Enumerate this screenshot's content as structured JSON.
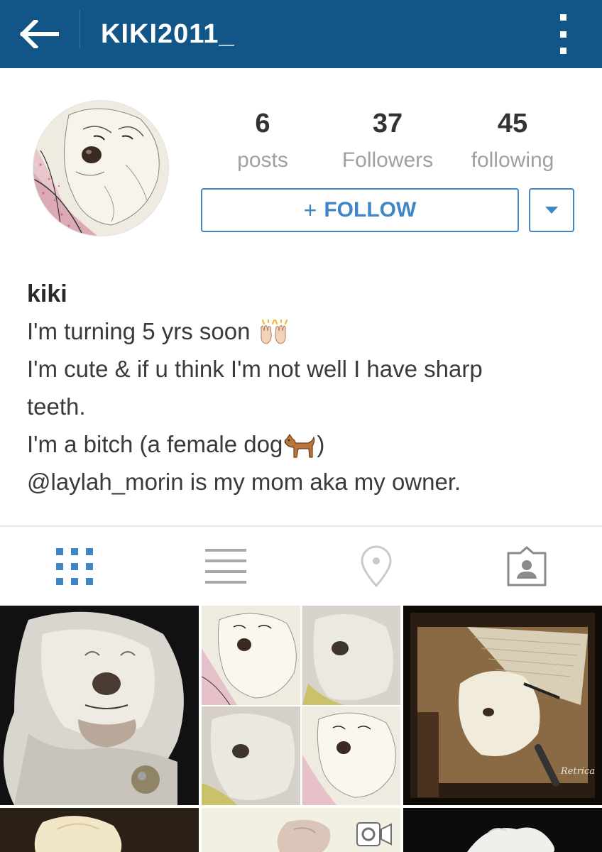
{
  "app": {
    "username": "KIKI2011_",
    "back_icon": "arrow-left-icon",
    "overflow_icon": "more-vert-icon",
    "bar_color": "#125688"
  },
  "profile": {
    "stats": [
      {
        "value": "6",
        "label": "posts"
      },
      {
        "value": "37",
        "label": "Followers"
      },
      {
        "value": "45",
        "label": "following"
      }
    ],
    "follow_label": "FOLLOW",
    "follow_prefix": "+",
    "accent_color": "#3f86c7"
  },
  "bio": {
    "name": "kiki",
    "line1": "I'm turning 5 yrs soon",
    "line1_emoji": "raised-hands-icon",
    "line2": "I'm cute & if u think I'm not well I have sharp",
    "line3": "teeth.",
    "line4a": "I'm a bitch (a female dog",
    "line4_emoji": "dog-icon",
    "line4b": ")",
    "line5": "@laylah_morin is my mom aka my owner."
  },
  "tabs": [
    {
      "name": "grid-view-icon",
      "active": true
    },
    {
      "name": "list-view-icon",
      "active": false
    },
    {
      "name": "location-pin-icon",
      "active": false
    },
    {
      "name": "tagged-photos-icon",
      "active": false
    }
  ],
  "grid": {
    "watermark": "Retrica",
    "video_icon": "video-camera-icon"
  }
}
